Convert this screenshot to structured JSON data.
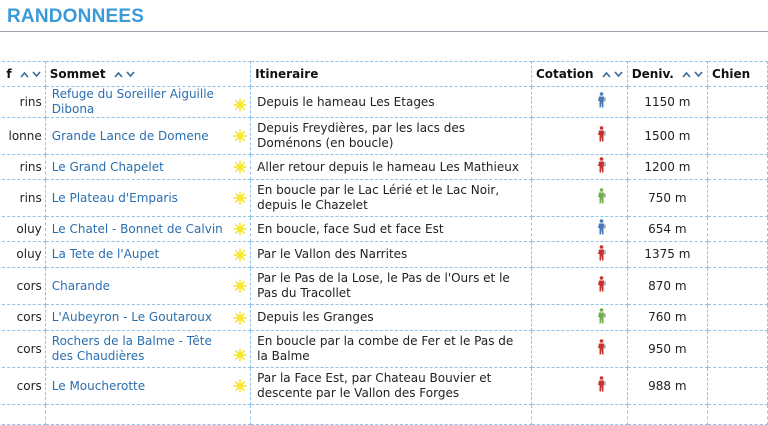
{
  "page": {
    "title": "RANDONNEES"
  },
  "table": {
    "headers": {
      "massif": "f",
      "sommet": "Sommet",
      "itineraire": "Itineraire",
      "cotation": "Cotation",
      "deniv": "Deniv.",
      "chien": "Chien"
    },
    "colors": {
      "link": "#2a6fb0",
      "border": "#8fc3ea",
      "sun": "#f3e21a",
      "walker_red": "#c8322a",
      "walker_green": "#6fb04c",
      "walker_blue": "#4a79b8"
    },
    "rows": [
      {
        "massif": "rins",
        "sommet": "Refuge du Soreiller Aiguille Dibona",
        "itineraire": "Depuis le hameau Les Etages",
        "cotation": "blue",
        "deniv": "1150 m",
        "sun": "bottom"
      },
      {
        "massif": "lonne",
        "sommet": "Grande Lance de Domene",
        "itineraire": "Depuis Freydières, par les lacs des Doménons (en boucle)",
        "cotation": "red",
        "deniv": "1500 m",
        "sun": "middle"
      },
      {
        "massif": "rins",
        "sommet": "Le Grand Chapelet",
        "itineraire": "Aller retour depuis le hameau Les Mathieux",
        "cotation": "red",
        "deniv": "1200 m",
        "sun": "middle"
      },
      {
        "massif": "rins",
        "sommet": "Le Plateau d'Emparis",
        "itineraire": "En boucle par le Lac Lérié et le Lac Noir, depuis le Chazelet",
        "cotation": "green",
        "deniv": "750 m",
        "sun": "middle"
      },
      {
        "massif": "oluy",
        "sommet": "Le Chatel - Bonnet de Calvin",
        "itineraire": "En boucle, face Sud et face Est",
        "cotation": "blue",
        "deniv": "654 m",
        "sun": "middle"
      },
      {
        "massif": "oluy",
        "sommet": "La Tete de l'Aupet",
        "itineraire": "Par le Vallon des Narrites",
        "cotation": "red",
        "deniv": "1375 m",
        "sun": "middle"
      },
      {
        "massif": "cors",
        "sommet": "Charande",
        "itineraire": "Par le Pas de la Lose, le Pas de l'Ours et le Pas du Tracollet",
        "cotation": "red",
        "deniv": "870 m",
        "sun": "middle"
      },
      {
        "massif": "cors",
        "sommet": "L'Aubeyron - Le Goutaroux",
        "itineraire": "Depuis les Granges",
        "cotation": "green",
        "deniv": "760 m",
        "sun": "middle"
      },
      {
        "massif": "cors",
        "sommet": "Rochers de la Balme - Tête des Chaudières",
        "itineraire": "En boucle par la combe de Fer et le Pas de la Balme",
        "cotation": "red",
        "deniv": "950 m",
        "sun": "bottom"
      },
      {
        "massif": "cors",
        "sommet": "Le Moucherotte",
        "itineraire": "Par la Face Est, par Chateau Bouvier et descente par le Vallon des Forges",
        "cotation": "red",
        "deniv": "988 m",
        "sun": "middle"
      }
    ]
  }
}
